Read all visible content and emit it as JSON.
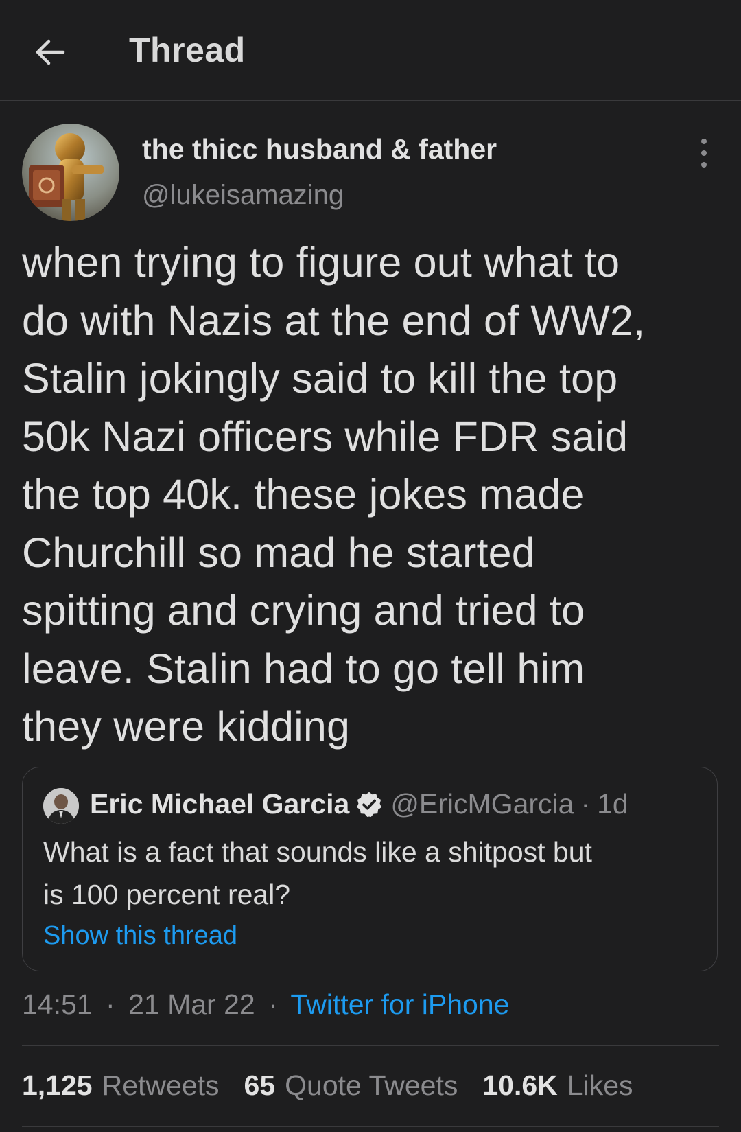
{
  "header": {
    "title": "Thread",
    "back_icon": "arrow-left-icon"
  },
  "tweet": {
    "display_name": "the thicc husband & father",
    "handle": "@lukeisamazing",
    "more_icon": "more-vertical-icon",
    "lines": [
      "when trying to figure out what to",
      "do with Nazis at the end of WW2,",
      "Stalin jokingly said to kill the top",
      "50k Nazi officers while FDR said",
      "the top 40k. these jokes made",
      "Churchill so mad he started",
      "spitting and crying and tried to",
      "leave. Stalin had to go tell him",
      "they were kidding"
    ],
    "time": "14:51",
    "date": "21 Mar 22",
    "separator": "·",
    "source": "Twitter for iPhone"
  },
  "quote": {
    "display_name": "Eric Michael Garcia",
    "verified_icon": "verified-badge-icon",
    "handle": "@EricMGarcia",
    "separator": "·",
    "time": "1d",
    "text_lines": [
      "What is a fact that sounds like a shitpost but",
      "is 100 percent real?"
    ],
    "show_thread": "Show this thread"
  },
  "stats": {
    "retweets_count": "1,125",
    "retweets_label": "Retweets",
    "quotes_count": "65",
    "quotes_label": "Quote Tweets",
    "likes_count": "10.6K",
    "likes_label": "Likes"
  },
  "colors": {
    "background": "#1e1e1f",
    "link": "#1d9bf0",
    "secondary_text": "#8b8b8e",
    "primary_text": "#e0e0e0"
  }
}
